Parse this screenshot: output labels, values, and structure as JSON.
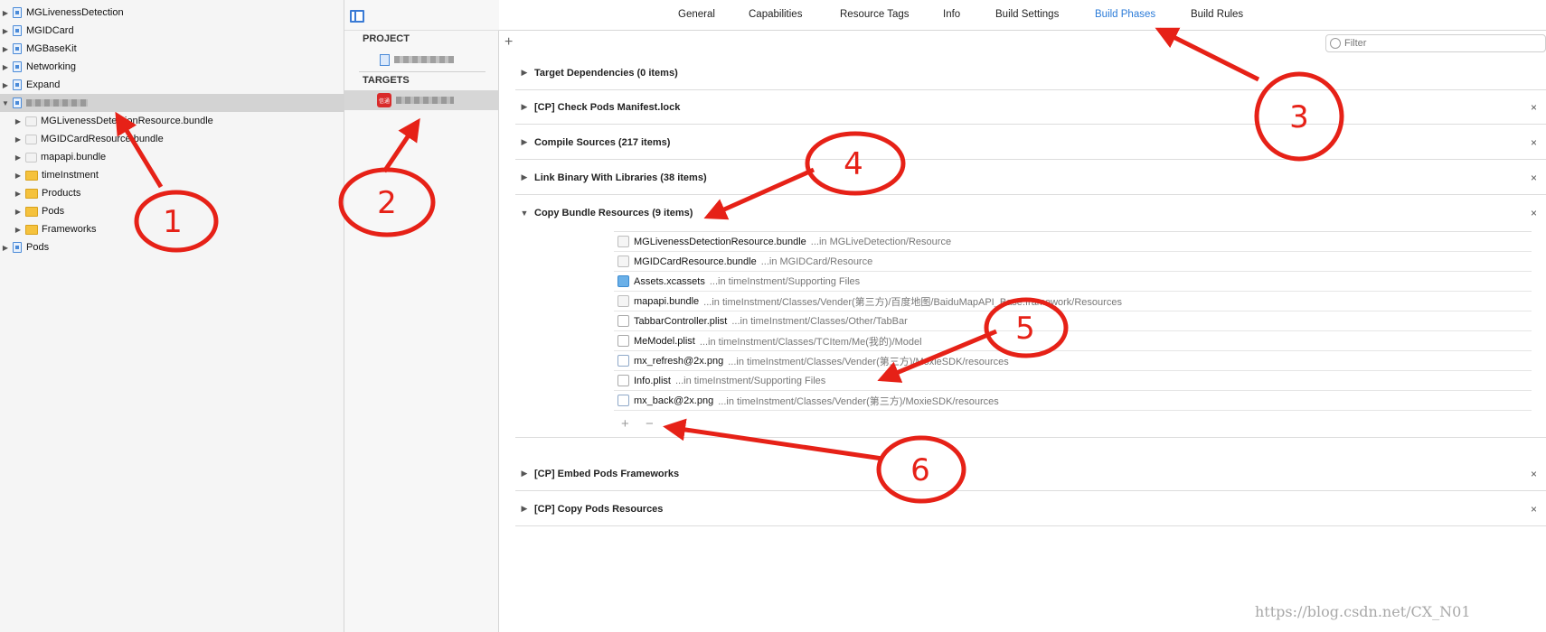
{
  "navigator": {
    "rows": [
      {
        "label": "MGLivenessDetection",
        "kind": "file",
        "expanded": false
      },
      {
        "label": "MGIDCard",
        "kind": "file",
        "expanded": false
      },
      {
        "label": "MGBaseKit",
        "kind": "file",
        "expanded": false
      },
      {
        "label": "Networking",
        "kind": "file",
        "expanded": false
      },
      {
        "label": "Expand",
        "kind": "file",
        "expanded": false
      },
      {
        "label": "",
        "kind": "file",
        "expanded": true,
        "selected": true
      },
      {
        "label": "MGLivenessDetectionResource.bundle",
        "kind": "bundle",
        "expanded": false
      },
      {
        "label": "MGIDCardResource.bundle",
        "kind": "bundle",
        "expanded": false
      },
      {
        "label": "mapapi.bundle",
        "kind": "bundle",
        "expanded": false
      },
      {
        "label": "timeInstment",
        "kind": "folder",
        "expanded": false
      },
      {
        "label": "Products",
        "kind": "folder",
        "expanded": false
      },
      {
        "label": "Pods",
        "kind": "folder",
        "expanded": false
      },
      {
        "label": "Frameworks",
        "kind": "folder",
        "expanded": false
      },
      {
        "label": "Pods",
        "kind": "file",
        "expanded": false
      }
    ]
  },
  "targets_pane": {
    "project_header": "PROJECT",
    "targets_header": "TARGETS",
    "app_icon_text": "信通"
  },
  "tabs": [
    {
      "label": "General",
      "active": false
    },
    {
      "label": "Capabilities",
      "active": false
    },
    {
      "label": "Resource Tags",
      "active": false
    },
    {
      "label": "Info",
      "active": false
    },
    {
      "label": "Build Settings",
      "active": false
    },
    {
      "label": "Build Phases",
      "active": true
    },
    {
      "label": "Build Rules",
      "active": false
    }
  ],
  "toolbar": {
    "add_label": "+",
    "filter_placeholder": "Filter"
  },
  "phases": [
    {
      "title": "Target Dependencies (0 items)",
      "expanded": false,
      "closable": false
    },
    {
      "title": "[CP] Check Pods Manifest.lock",
      "expanded": false,
      "closable": true
    },
    {
      "title": "Compile Sources (217 items)",
      "expanded": false,
      "closable": true
    },
    {
      "title": "Link Binary With Libraries (38 items)",
      "expanded": false,
      "closable": true
    },
    {
      "title": "Copy Bundle Resources (9 items)",
      "expanded": true,
      "closable": true
    },
    {
      "title": "[CP] Embed Pods Frameworks",
      "expanded": false,
      "closable": true
    },
    {
      "title": "[CP] Copy Pods Resources",
      "expanded": false,
      "closable": true
    }
  ],
  "bundle_resources": [
    {
      "name": "MGLivenessDetectionResource.bundle",
      "path": "...in MGLiveDetection/Resource",
      "icon": "bundle"
    },
    {
      "name": "MGIDCardResource.bundle",
      "path": "...in MGIDCard/Resource",
      "icon": "bundle"
    },
    {
      "name": "Assets.xcassets",
      "path": "...in timeInstment/Supporting Files",
      "icon": "assets"
    },
    {
      "name": "mapapi.bundle",
      "path": "...in timeInstment/Classes/Vender(第三方)/百度地图/BaiduMapAPI_Base.framework/Resources",
      "icon": "bundle"
    },
    {
      "name": "TabbarController.plist",
      "path": "...in timeInstment/Classes/Other/TabBar",
      "icon": "plist"
    },
    {
      "name": "MeModel.plist",
      "path": "...in timeInstment/Classes/TCItem/Me(我的)/Model",
      "icon": "plist"
    },
    {
      "name": "mx_refresh@2x.png",
      "path": "...in timeInstment/Classes/Vender(第三方)/MoxieSDK/resources",
      "icon": "png"
    },
    {
      "name": "Info.plist",
      "path": "...in timeInstment/Supporting Files",
      "icon": "plist"
    },
    {
      "name": "mx_back@2x.png",
      "path": "...in timeInstment/Classes/Vender(第三方)/MoxieSDK/resources",
      "icon": "png"
    }
  ],
  "list_controls": {
    "add": "+",
    "remove": "−"
  },
  "close_glyph": "×",
  "annotations": [
    "1",
    "2",
    "3",
    "4",
    "5",
    "6"
  ],
  "annotation_color": "#e62117",
  "watermark": "https://blog.csdn.net/CX_N01",
  "colors": {
    "accent": "#2b7bd8",
    "selection": "#d3d3d3"
  }
}
